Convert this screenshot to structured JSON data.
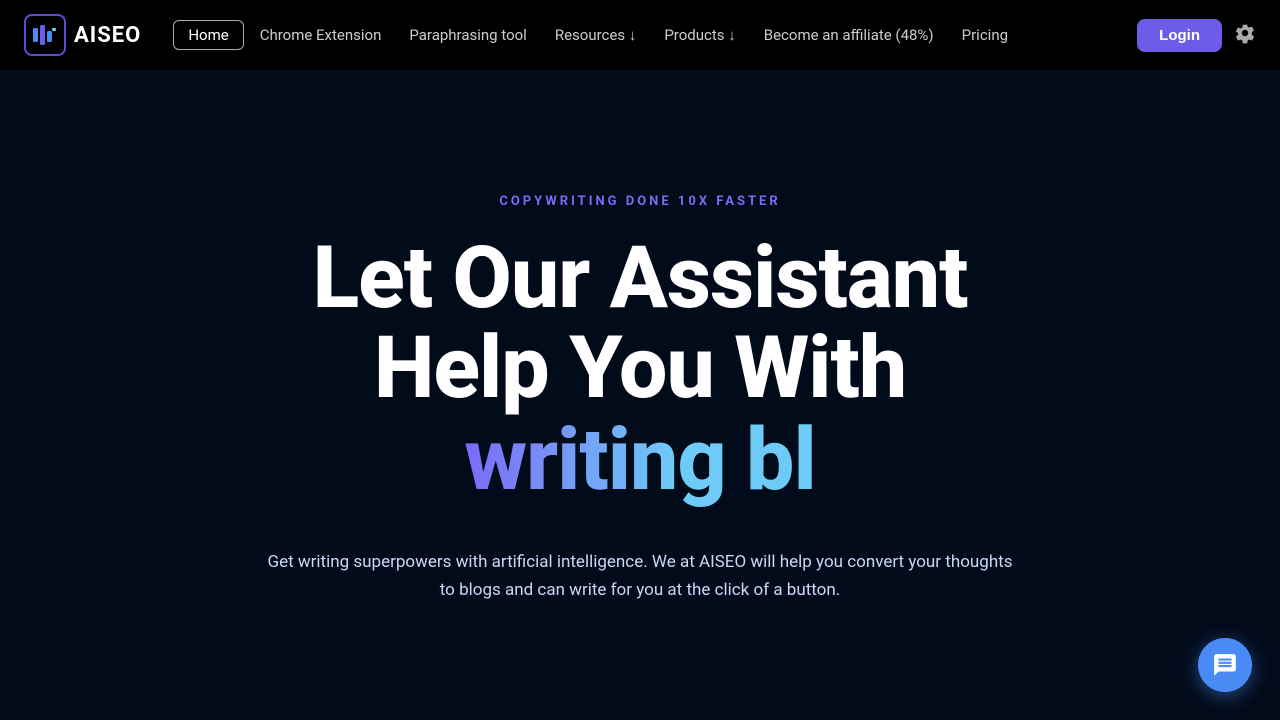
{
  "navbar": {
    "logo_text": "AISEO",
    "links": [
      {
        "label": "Home",
        "active": true
      },
      {
        "label": "Chrome Extension",
        "active": false
      },
      {
        "label": "Paraphrasing tool",
        "active": false
      },
      {
        "label": "Resources ↓",
        "active": false
      },
      {
        "label": "Products ↓",
        "active": false
      },
      {
        "label": "Become an affiliate (48%)",
        "active": false
      },
      {
        "label": "Pricing",
        "active": false
      }
    ],
    "login_label": "Login"
  },
  "hero": {
    "eyebrow": "COPYWRITING DONE 10X FASTER",
    "title_line1": "Let Our Assistant",
    "title_line2": "Help You With",
    "title_line3": "writing bl",
    "description": "Get writing superpowers with artificial intelligence. We at AISEO will help you convert your thoughts to blogs and can write for you at the click of a button."
  }
}
